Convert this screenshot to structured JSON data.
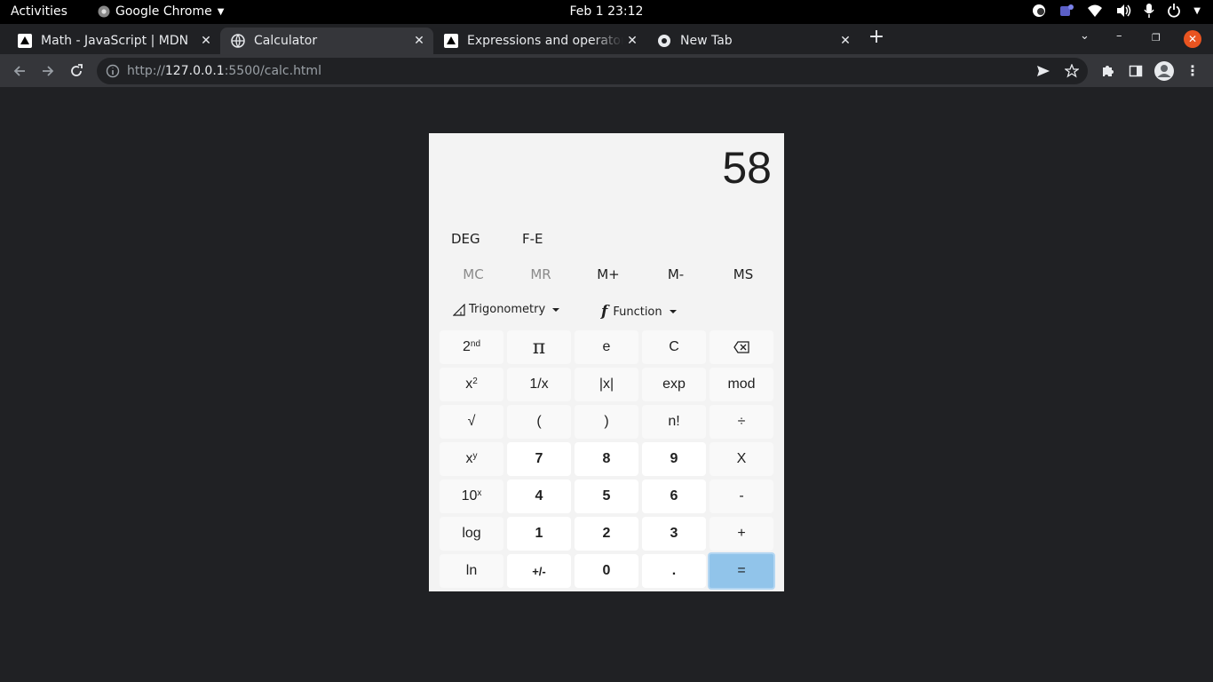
{
  "system": {
    "activities": "Activities",
    "app_name": "Google Chrome",
    "clock": "Feb 1  23:12"
  },
  "tabs": [
    {
      "title": "Math - JavaScript | MDN",
      "favicon": "mdn-icon"
    },
    {
      "title": "Calculator",
      "favicon": "globe-icon",
      "active": true
    },
    {
      "title": "Expressions and operators",
      "favicon": "mdn-icon"
    },
    {
      "title": "New Tab",
      "favicon": "chrome-icon"
    }
  ],
  "newtab_label": "+",
  "omnibox": {
    "scheme": "http://",
    "host": "127.0.0.1",
    "path": ":5500/calc.html"
  },
  "calculator": {
    "display": "58",
    "modes": {
      "angle": "DEG",
      "fe": "F-E"
    },
    "memory": [
      {
        "label": "MC",
        "enabled": false
      },
      {
        "label": "MR",
        "enabled": false
      },
      {
        "label": "M+",
        "enabled": true
      },
      {
        "label": "M-",
        "enabled": true
      },
      {
        "label": "MS",
        "enabled": true
      }
    ],
    "dropdowns": {
      "trig": "Trigonometry",
      "func": "Function"
    },
    "keys": [
      [
        "2nd",
        "π",
        "e",
        "C",
        "⌫"
      ],
      [
        "x2",
        "1/x",
        "|x|",
        "exp",
        "mod"
      ],
      [
        "√",
        "(",
        ")",
        "n!",
        "÷"
      ],
      [
        "xy",
        "7",
        "8",
        "9",
        "X"
      ],
      [
        "10x",
        "4",
        "5",
        "6",
        "-"
      ],
      [
        "log",
        "1",
        "2",
        "3",
        "+"
      ],
      [
        "ln",
        "+/-",
        "0",
        ".",
        "="
      ]
    ]
  },
  "colors": {
    "equals": "#91c4ea",
    "close_window": "#e95420"
  }
}
